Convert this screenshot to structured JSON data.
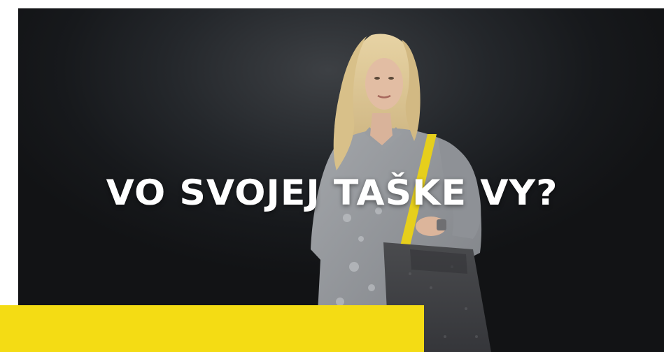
{
  "headline": "VO SVOJEJ TAŠKE VY?",
  "colors": {
    "background": "#1b1d20",
    "accent_yellow": "#f4dc14",
    "headline_text": "#ffffff"
  }
}
